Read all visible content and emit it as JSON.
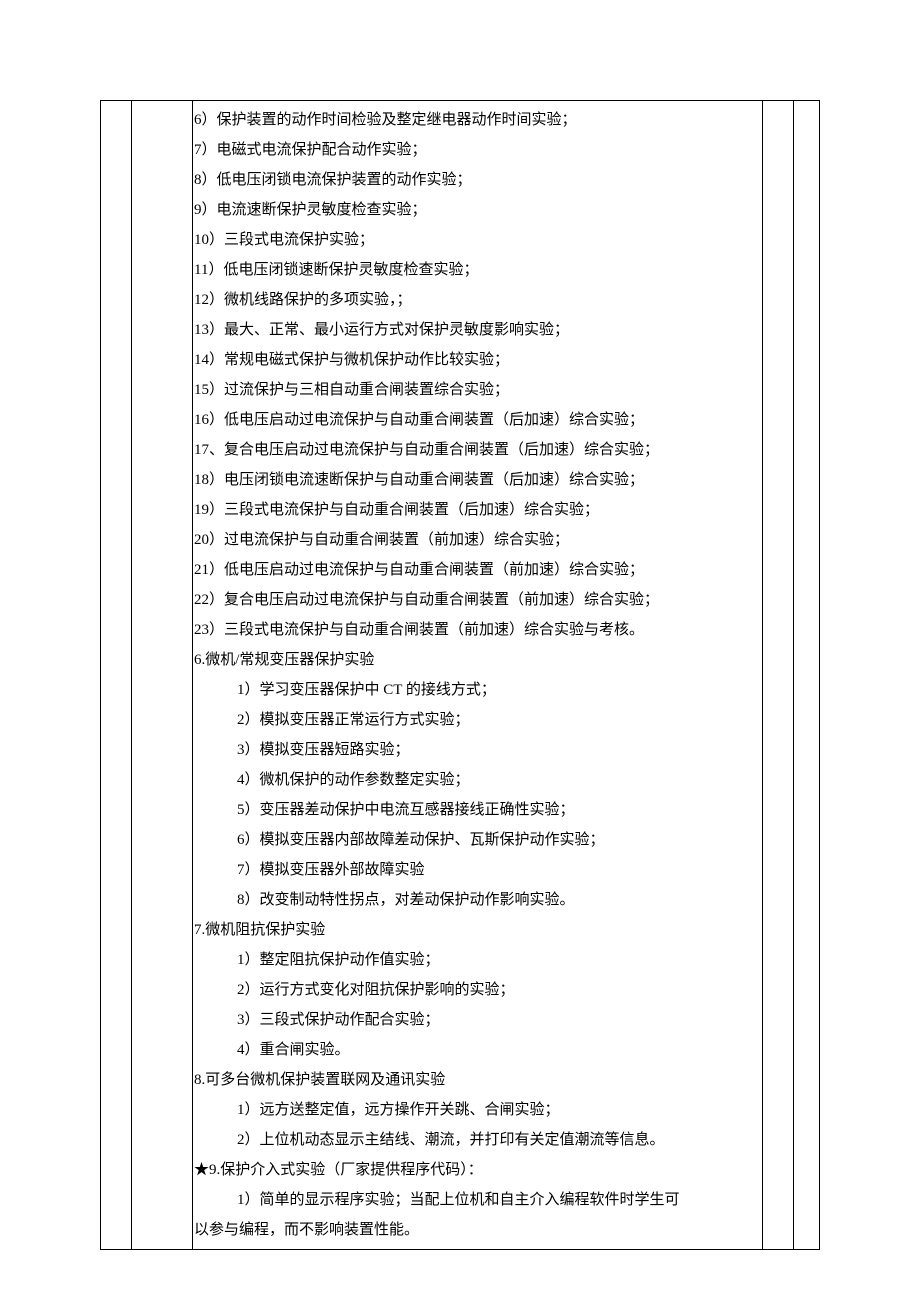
{
  "items": [
    "6）保护装置的动作时间检验及整定继电器动作时间实验；",
    "7）电磁式电流保护配合动作实验；",
    "8）低电压闭锁电流保护装置的动作实验；",
    "9）电流速断保护灵敏度检查实验；",
    "10）三段式电流保护实验；",
    "11）低电压闭锁速断保护灵敏度检查实验；",
    "12）微机线路保护的多项实验，；",
    "13）最大、正常、最小运行方式对保护灵敏度影响实验；",
    "14）常规电磁式保护与微机保护动作比较实验；",
    "15）过流保护与三相自动重合闸装置综合实验；",
    "16）低电压启动过电流保护与自动重合闸装置（后加速）综合实验；",
    "17、复合电压启动过电流保护与自动重合闸装置（后加速）综合实验；",
    "18）电压闭锁电流速断保护与自动重合闸装置（后加速）综合实验；",
    "19）三段式电流保护与自动重合闸装置（后加速）综合实验；",
    "20）过电流保护与自动重合闸装置（前加速）综合实验；",
    "21）低电压启动过电流保护与自动重合闸装置（前加速）综合实验；",
    "22）复合电压启动过电流保护与自动重合闸装置（前加速）综合实验；",
    "23）三段式电流保护与自动重合闸装置（前加速）综合实验与考核。"
  ],
  "section6_title": "6.微机/常规变压器保护实验",
  "section6_items": [
    "1）学习变压器保护中 CT 的接线方式；",
    "2）模拟变压器正常运行方式实验；",
    "3）模拟变压器短路实验；",
    "4）微机保护的动作参数整定实验；",
    "5）变压器差动保护中电流互感器接线正确性实验；",
    "6）模拟变压器内部故障差动保护、瓦斯保护动作实验；",
    "7）模拟变压器外部故障实验",
    "8）改变制动特性拐点，对差动保护动作影响实验。"
  ],
  "section7_title": "7.微机阻抗保护实验",
  "section7_items": [
    "1）整定阻抗保护动作值实验；",
    "2）运行方式变化对阻抗保护影响的实验；",
    "3）三段式保护动作配合实验；",
    "4）重合闸实验。"
  ],
  "section8_title": "8.可多台微机保护装置联网及通讯实验",
  "section8_items": [
    "1）远方送整定值，远方操作开关跳、合闸实验；",
    "2）上位机动态显示主结线、潮流，并打印有关定值潮流等信息。"
  ],
  "section9_title": "★9.保护介入式实验（厂家提供程序代码）：",
  "section9_item1_a": "1）简单的显示程序实验；当配上位机和自主介入编程软件时学生可",
  "section9_item1_b": "以参与编程，而不影响装置性能。"
}
